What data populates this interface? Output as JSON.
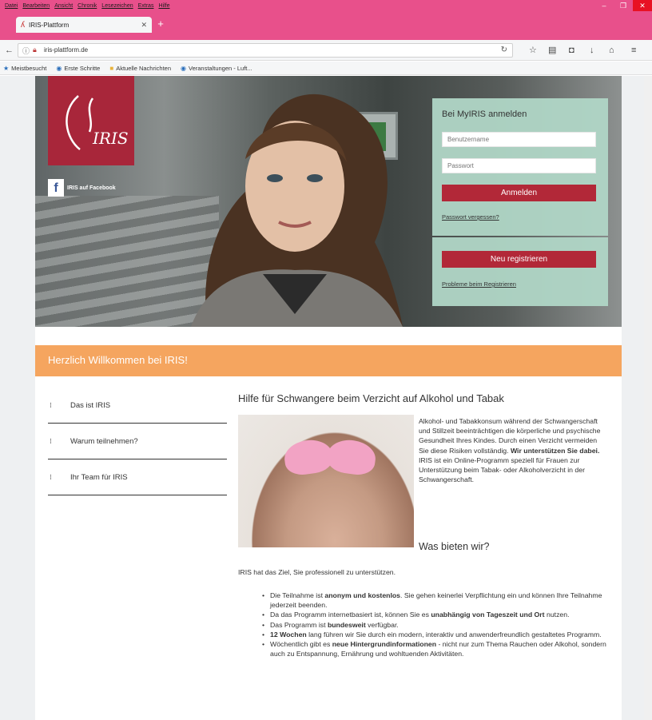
{
  "browser": {
    "menu": [
      "Datei",
      "Bearbeiten",
      "Ansicht",
      "Chronik",
      "Lesezeichen",
      "Extras",
      "Hilfe"
    ],
    "tab_title": "IRIS-Plattform",
    "url": "iris-plattform.de",
    "bookmarks": [
      {
        "label": "Meistbesucht",
        "icon": "star-icon"
      },
      {
        "label": "Erste Schritte",
        "icon": "firefox-icon"
      },
      {
        "label": "Aktuelle Nachrichten",
        "icon": "folder-icon"
      },
      {
        "label": "Veranstaltungen - Luft...",
        "icon": "firefox-icon"
      }
    ],
    "accent": "#e8508b"
  },
  "hero": {
    "logo_text": "IRIS",
    "facebook_label": "IRIS auf Facebook"
  },
  "login": {
    "title": "Bei MyIRIS anmelden",
    "username_placeholder": "Benutzername",
    "password_placeholder": "Passwort",
    "login_button": "Anmelden",
    "forgot_link": "Passwort vergessen?",
    "register_button": "Neu registrieren",
    "register_problems_link": "Probleme beim Registrieren",
    "button_color": "#b22838"
  },
  "welcome": {
    "text": "Herzlich Willkommen bei IRIS!",
    "color": "#f5a55f"
  },
  "sidebar": {
    "items": [
      {
        "label": "Das ist IRIS"
      },
      {
        "label": "Warum teilnehmen?"
      },
      {
        "label": "Ihr Team für IRIS"
      }
    ]
  },
  "content": {
    "heading": "Hilfe für Schwangere beim Verzicht auf Alkohol und Tabak",
    "intro_part1": "Alkohol- und Tabakkonsum während der Schwangerschaft und Stillzeit beeinträchtigen die körperliche und psychische Gesundheit Ihres Kindes. Durch einen Verzicht vermeiden Sie diese Risiken vollständig. ",
    "intro_bold": "Wir unterstützen Sie dabei.",
    "intro_part2": " IRIS ist ein Online-Programm speziell für Frauen zur Unterstützung beim Tabak- oder Alkoholverzicht in der Schwangerschaft.",
    "subheading": "Was bieten wir?",
    "goal": "IRIS hat das Ziel, Sie professionell zu unterstützen.",
    "bullets": [
      {
        "pre": "Die Teilnahme ist ",
        "bold": "anonym und kostenlos",
        "post": ". Sie gehen keinerlei Verpflichtung ein und können Ihre Teilnahme jederzeit beenden."
      },
      {
        "pre": "Da das Programm internetbasiert ist, können Sie es ",
        "bold": "unabhängig von Tageszeit und Ort",
        "post": " nutzen."
      },
      {
        "pre": "Das Programm ist ",
        "bold": "bundesweit",
        "post": " verfügbar."
      },
      {
        "pre": "",
        "bold": "12 Wochen",
        "post": " lang führen wir Sie durch ein modern, interaktiv und anwenderfreundlich gestaltetes Programm."
      },
      {
        "pre": "Wöchentlich gibt es ",
        "bold": "neue Hintergrundinformationen",
        "post": " - nicht nur zum Thema Rauchen oder Alkohol, sondern auch zu Entspannung, Ernährung und wohltuenden Aktivitäten."
      }
    ]
  }
}
